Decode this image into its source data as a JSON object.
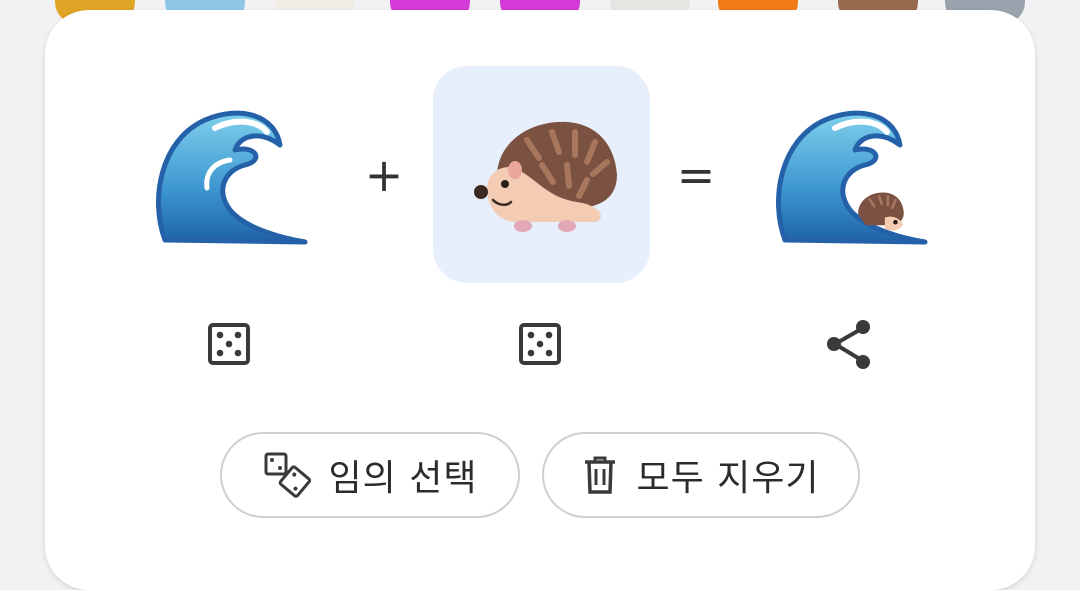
{
  "strip": {
    "tiles": [
      {
        "icon": "emoji-tile-icon",
        "color": "#e0a526"
      },
      {
        "icon": "emoji-tile-icon",
        "color": "#8fc6e8"
      },
      {
        "icon": "emoji-tile-icon",
        "color": "#f1ece6"
      },
      {
        "icon": "emoji-tile-icon",
        "color": "#d53bd8"
      },
      {
        "icon": "emoji-tile-icon",
        "color": "#d53bd8"
      },
      {
        "icon": "emoji-tile-icon",
        "color": "#e8e6e2"
      },
      {
        "icon": "emoji-tile-icon",
        "color": "#f07a16"
      },
      {
        "icon": "emoji-tile-icon",
        "color": "#9a6a4e"
      },
      {
        "icon": "emoji-tile-icon",
        "color": "#9aa3ad"
      }
    ]
  },
  "kitchen": {
    "left_emoji": "water-wave-icon",
    "right_emoji": "hedgehog-icon",
    "result_emoji": "wave-hedgehog-mix-icon",
    "plus": "+",
    "equals": "=",
    "left_random_icon": "dice-icon",
    "right_random_icon": "dice-icon",
    "share_icon": "share-icon"
  },
  "actions": {
    "randomize_label": "임의 선택",
    "randomize_icon": "dice-pair-icon",
    "clear_label": "모두 지우기",
    "clear_icon": "trash-icon"
  },
  "colors": {
    "selected_slot_bg": "#e8effc",
    "wave_blue": "#2b7bc0",
    "hedgehog_brown": "#7b5142"
  }
}
